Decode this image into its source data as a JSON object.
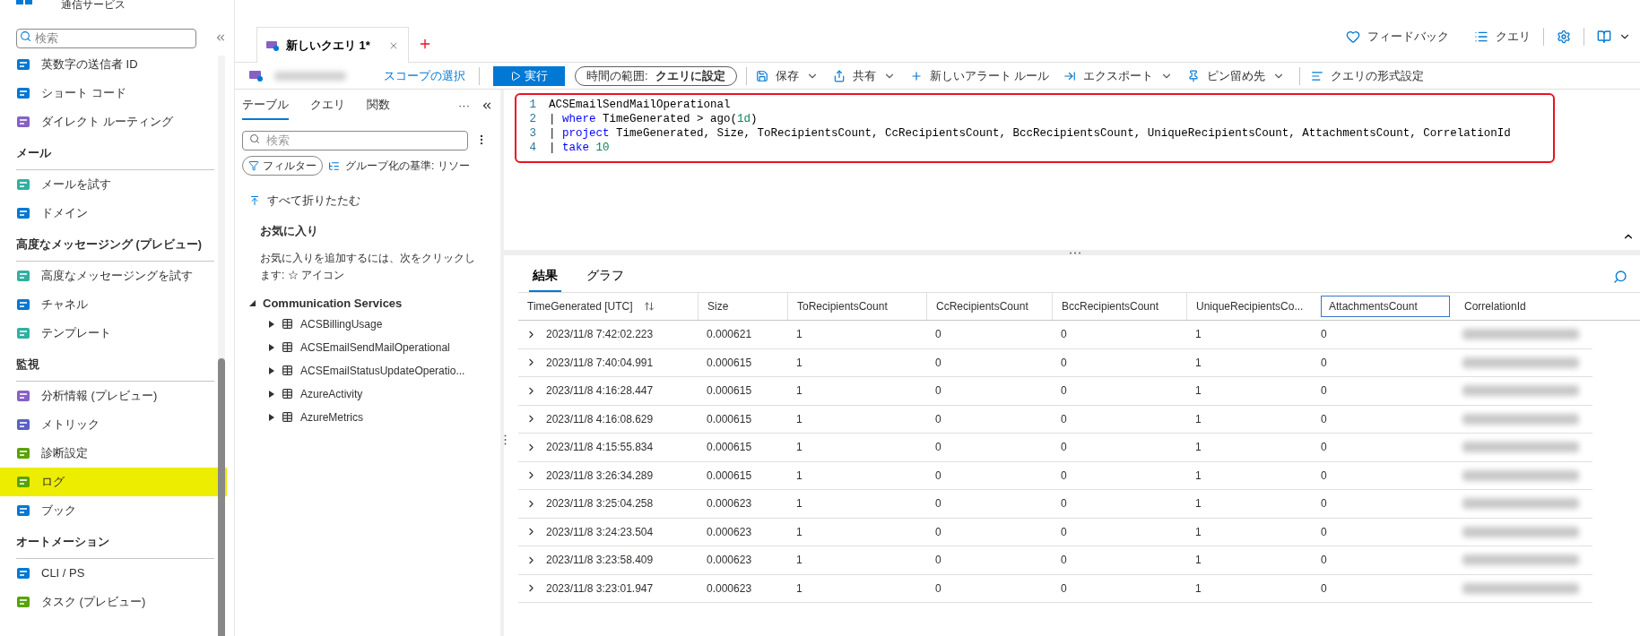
{
  "sidebar": {
    "title": "通信サービス",
    "search_placeholder": "検索",
    "sections": [
      {
        "items": [
          {
            "label": "英数字の送信者 ID",
            "selected": false
          },
          {
            "label": "ショート コード",
            "selected": false
          },
          {
            "label": "ダイレクト ルーティング",
            "selected": false
          }
        ]
      },
      {
        "header": "メール",
        "items": [
          {
            "label": "メールを試す",
            "selected": false
          },
          {
            "label": "ドメイン",
            "selected": false
          }
        ]
      },
      {
        "header": "高度なメッセージング (プレビュー)",
        "items": [
          {
            "label": "高度なメッセージングを試す",
            "selected": false
          },
          {
            "label": "チャネル",
            "selected": false
          },
          {
            "label": "テンプレート",
            "selected": false
          }
        ]
      },
      {
        "header": "監視",
        "items": [
          {
            "label": "分析情報 (プレビュー)",
            "selected": false
          },
          {
            "label": "メトリック",
            "selected": false
          },
          {
            "label": "診断設定",
            "selected": false
          },
          {
            "label": "ログ",
            "selected": true
          },
          {
            "label": "ブック",
            "selected": false
          }
        ]
      },
      {
        "header": "オートメーション",
        "items": [
          {
            "label": "CLI / PS",
            "selected": false
          },
          {
            "label": "タスク (プレビュー)",
            "selected": false
          }
        ]
      }
    ]
  },
  "query_tab": {
    "label": "新しいクエリ 1*"
  },
  "top_links": [
    "フィードバック",
    "クエリ"
  ],
  "toolbar": {
    "scope_link": "スコープの選択",
    "run": "実行",
    "time_range_label": "時間の範囲:",
    "time_range_value": "クエリに設定",
    "actions": [
      {
        "label": "保存",
        "dropdown": true
      },
      {
        "label": "共有",
        "dropdown": true
      },
      {
        "label": "新しいアラート ルール",
        "dropdown": false
      },
      {
        "label": "エクスポート",
        "dropdown": true
      },
      {
        "label": "ピン留め先",
        "dropdown": true
      },
      {
        "label": "クエリの形式設定",
        "dropdown": false
      }
    ]
  },
  "schema_panel": {
    "tabs": [
      {
        "label": "テーブル",
        "selected": true
      },
      {
        "label": "クエリ",
        "selected": false
      },
      {
        "label": "関数",
        "selected": false
      }
    ],
    "more": "···",
    "search_placeholder": "検索",
    "filter": "フィルター",
    "group_by": "グループ化の基準: リソー",
    "collapse_all": "すべて折りたたむ",
    "favorites_title": "お気に入り",
    "favorites_hint": "お気に入りを追加するには、次をクリックします:  ☆ アイコン",
    "tree": [
      {
        "label": "Communication Services",
        "expanded": true,
        "children": [
          {
            "label": "ACSBillingUsage",
            "expanded": false
          },
          {
            "label": "ACSEmailSendMailOperational",
            "expanded": false
          },
          {
            "label": "ACSEmailStatusUpdateOperatio...",
            "expanded": false
          },
          {
            "label": "AzureActivity",
            "expanded": false
          },
          {
            "label": "AzureMetrics",
            "expanded": false
          }
        ]
      }
    ]
  },
  "editor": {
    "lines": [
      {
        "number": "1",
        "tokens": [
          {
            "kind": "plain",
            "text": "ACSEmailSendMailOperational"
          }
        ]
      },
      {
        "number": "2",
        "tokens": [
          {
            "kind": "plain",
            "text": "| "
          },
          {
            "kind": "keyword",
            "text": "where"
          },
          {
            "kind": "plain",
            "text": " TimeGenerated > ago("
          },
          {
            "kind": "number",
            "text": "1d"
          },
          {
            "kind": "plain",
            "text": ")"
          }
        ]
      },
      {
        "number": "3",
        "tokens": [
          {
            "kind": "plain",
            "text": "| "
          },
          {
            "kind": "keyword",
            "text": "project"
          },
          {
            "kind": "plain",
            "text": " TimeGenerated, Size, ToRecipientsCount, CcRecipientsCount, BccRecipientsCount, UniqueRecipientsCount, AttachmentsCount, CorrelationId"
          }
        ]
      },
      {
        "number": "4",
        "tokens": [
          {
            "kind": "plain",
            "text": "| "
          },
          {
            "kind": "keyword",
            "text": "take"
          },
          {
            "kind": "number",
            "text": " 10"
          }
        ]
      }
    ]
  },
  "results": {
    "tabs": [
      {
        "label": "結果",
        "selected": true
      },
      {
        "label": "グラフ",
        "selected": false
      }
    ],
    "columns": [
      {
        "label": "TimeGenerated [UTC]",
        "focused": false
      },
      {
        "label": "Size",
        "focused": false
      },
      {
        "label": "ToRecipientsCount",
        "focused": false
      },
      {
        "label": "CcRecipientsCount",
        "focused": false
      },
      {
        "label": "BccRecipientsCount",
        "focused": false
      },
      {
        "label": "UniqueRecipientsCo...",
        "focused": false
      },
      {
        "label": "AttachmentsCount",
        "focused": true
      },
      {
        "label": "CorrelationId",
        "focused": false
      }
    ],
    "rows": [
      [
        "2023/11/8 7:42:02.223",
        "0.000621",
        "1",
        "0",
        "0",
        "1",
        "0"
      ],
      [
        "2023/11/8 7:40:04.991",
        "0.000615",
        "1",
        "0",
        "0",
        "1",
        "0"
      ],
      [
        "2023/11/8 4:16:28.447",
        "0.000615",
        "1",
        "0",
        "0",
        "1",
        "0"
      ],
      [
        "2023/11/8 4:16:08.629",
        "0.000615",
        "1",
        "0",
        "0",
        "1",
        "0"
      ],
      [
        "2023/11/8 4:15:55.834",
        "0.000615",
        "1",
        "0",
        "0",
        "1",
        "0"
      ],
      [
        "2023/11/8 3:26:34.289",
        "0.000615",
        "1",
        "0",
        "0",
        "1",
        "0"
      ],
      [
        "2023/11/8 3:25:04.258",
        "0.000623",
        "1",
        "0",
        "0",
        "1",
        "0"
      ],
      [
        "2023/11/8 3:24:23.504",
        "0.000623",
        "1",
        "0",
        "0",
        "1",
        "0"
      ],
      [
        "2023/11/8 3:23:58.409",
        "0.000623",
        "1",
        "0",
        "0",
        "1",
        "0"
      ],
      [
        "2023/11/8 3:23:01.947",
        "0.000623",
        "1",
        "0",
        "0",
        "1",
        "0"
      ]
    ]
  }
}
